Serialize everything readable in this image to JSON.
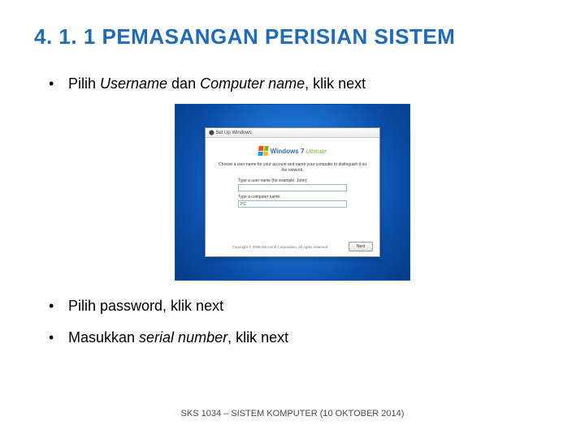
{
  "heading": "4. 1. 1 PEMASANGAN PERISIAN SISTEM",
  "bullet1": {
    "pre": "Pilih ",
    "italic1": "Username",
    "mid": " dan ",
    "italic2": "Computer name",
    "post": ", klik next"
  },
  "bullet2": "Pilih password, klik next",
  "bullet3": {
    "pre": "Masukkan ",
    "italic": "serial number",
    "post": ", klik next"
  },
  "dialog": {
    "titlebar": "⬤  Set Up Windows",
    "brand": "Windows",
    "brand_ver": "7",
    "brand_edition": "Ultimate",
    "instruction": "Choose a user name for your account and name your computer to distinguish it on the network.",
    "label_user": "Type a user name (for example, John):",
    "label_pc": "Type a computer name:",
    "value_pc": "PC",
    "copyright": "Copyright © 2009 Microsoft Corporation. All rights reserved.",
    "next_btn": "Next"
  },
  "footer": "SKS 1034 – SISTEM KOMPUTER (10 OKTOBER 2014)"
}
